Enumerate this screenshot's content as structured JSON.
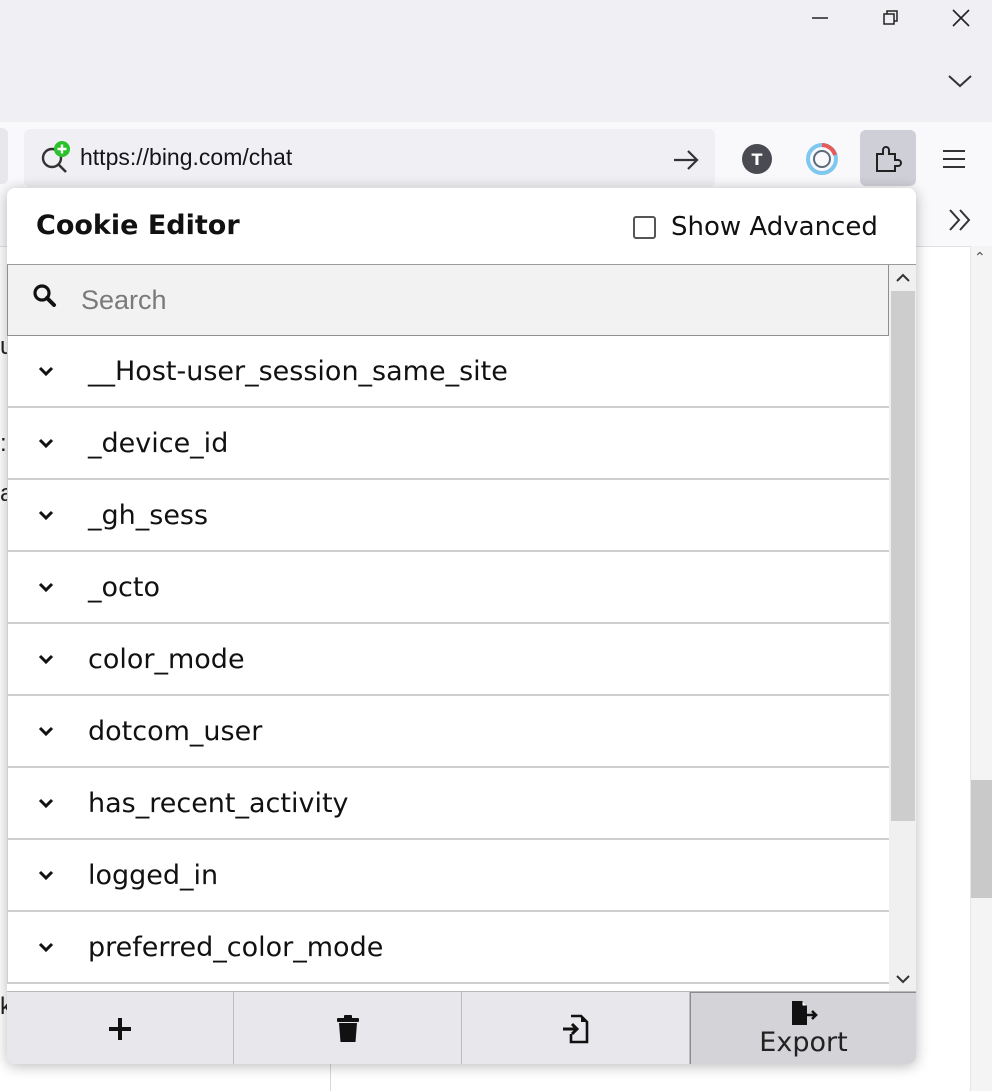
{
  "browser": {
    "url": "https://bing.com/chat",
    "avatar_letter": "T"
  },
  "popup": {
    "title": "Cookie Editor",
    "show_advanced_label": "Show Advanced",
    "search_placeholder": "Search",
    "cookies": [
      "__Host-user_session_same_site",
      "_device_id",
      "_gh_sess",
      "_octo",
      "color_mode",
      "dotcom_user",
      "has_recent_activity",
      "logged_in",
      "preferred_color_mode"
    ],
    "footer": {
      "add_icon": "plus-icon",
      "delete_icon": "trash-icon",
      "import_icon": "import-icon",
      "export_label": "Export"
    }
  },
  "page_fragments": {
    "frag1": "u",
    "frag2": ":",
    "frag3": "a",
    "frag4": "k"
  },
  "colors": {
    "accent_green": "#2ac12a",
    "ext_button_bg": "#cfcfd8"
  }
}
